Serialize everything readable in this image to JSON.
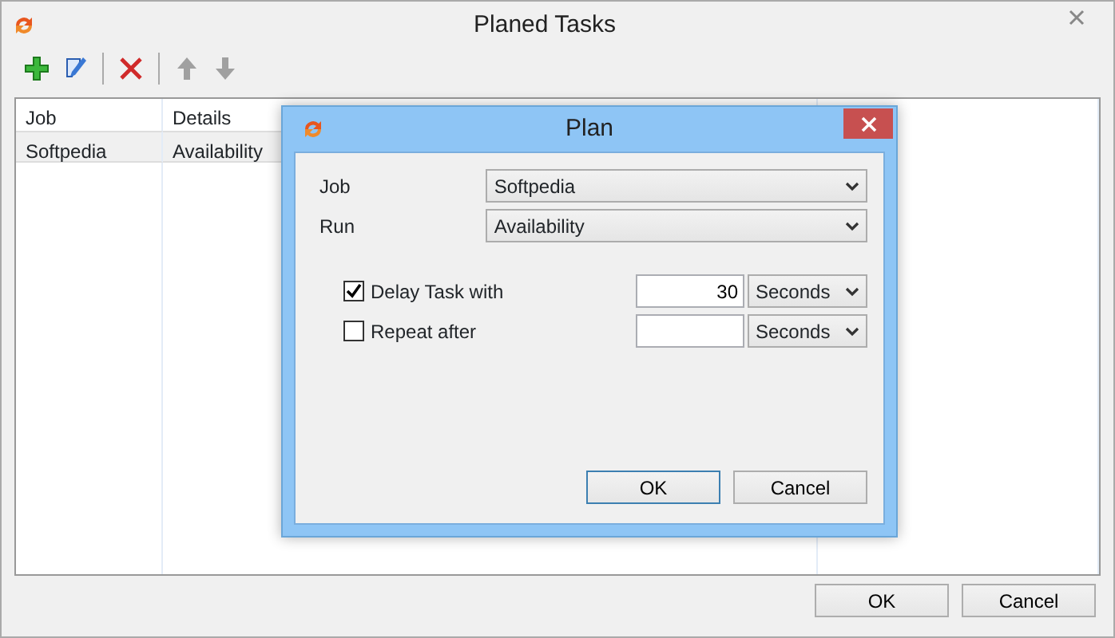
{
  "window": {
    "title": "Planed Tasks"
  },
  "toolbar": [
    {
      "kind": "add",
      "disabled": false
    },
    {
      "kind": "edit",
      "disabled": false
    },
    {
      "kind": "delete",
      "disabled": false
    },
    {
      "kind": "up",
      "disabled": true
    },
    {
      "kind": "down",
      "disabled": true
    }
  ],
  "table": {
    "columns": [
      "Job",
      "Details"
    ],
    "rows": [
      {
        "job": "Softpedia",
        "details": "Availability",
        "selected": true
      }
    ]
  },
  "buttons": [
    "OK",
    "Cancel"
  ],
  "dialog": {
    "title": "Plan",
    "fields": [
      {
        "label": "Job",
        "value": "Softpedia"
      },
      {
        "label": "Run",
        "value": "Availability"
      }
    ],
    "options": [
      {
        "label": "Delay Task with",
        "checked": true,
        "value": "30",
        "unit": "Seconds"
      },
      {
        "label": "Repeat after",
        "checked": false,
        "unit": "Seconds"
      }
    ],
    "buttons": [
      {
        "label": "OK",
        "selected": true
      },
      {
        "label": "Cancel",
        "selected": false
      }
    ]
  }
}
